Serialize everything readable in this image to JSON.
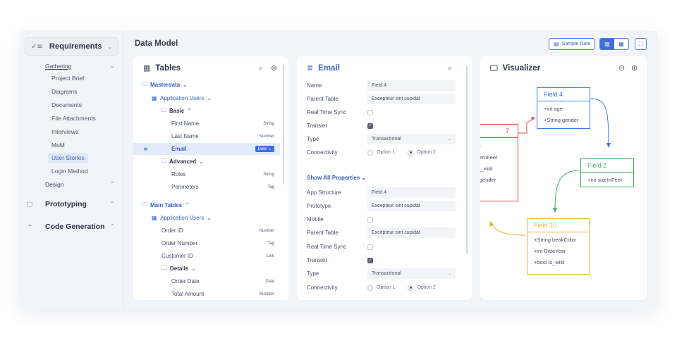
{
  "sidebar": {
    "requirements_label": "Requirements",
    "gathering_label": "Gathering",
    "gathering_items": [
      "Project Brief",
      "Diagrams",
      "Documents",
      "File Attachments",
      "Interviews",
      "MoM",
      "User Stories",
      "Login Method"
    ],
    "active_item": "User Stories",
    "design_label": "Design",
    "prototyping_label": "Prototyping",
    "code_generation_label": "Code Generation"
  },
  "header": {
    "title": "Data Model",
    "sample_data_label": "Sample Data"
  },
  "tables_panel": {
    "title": "Tables",
    "masterdata_label": "Masterdata",
    "application_users_label": "Application Users",
    "basic_label": "Basic",
    "basic_fields": [
      {
        "name": "First Name",
        "type": "String"
      },
      {
        "name": "Last Name",
        "type": "Number"
      }
    ],
    "selected_field": {
      "name": "Email",
      "type": "Date"
    },
    "advanced_label": "Advanced",
    "advanced_fields": [
      {
        "name": "Roles",
        "type": "String"
      },
      {
        "name": "Perimeters",
        "type": "Tag"
      }
    ],
    "main_tables_label": "Main Tables",
    "application_users_2_label": "Application Users",
    "main_fields": [
      {
        "name": "Order ID",
        "type": "Number"
      },
      {
        "name": "Order Number",
        "type": "Tag"
      },
      {
        "name": "Customer ID",
        "type": "Link"
      }
    ],
    "details_label": "Details",
    "details_fields": [
      {
        "name": "Order Date",
        "type": "Date"
      },
      {
        "name": "Total Amount",
        "type": "Number"
      }
    ]
  },
  "email_panel": {
    "title": "Email",
    "labels": {
      "name": "Name",
      "parent_table": "Parent Table",
      "real_time_sync": "Real Time Sync",
      "transiet": "Transiet",
      "type": "Type",
      "connectivity": "Connectivity",
      "app_structure": "App Structure",
      "prototype": "Prototype",
      "mobile": "Mobile"
    },
    "values": {
      "name": "Field 4",
      "parent_table": "Excepteur sint cupidat",
      "type": "Transactional",
      "app_structure": "Field 4",
      "prototype": "Excepteur sint cupidat",
      "parent_table_2": "Excepteur sint cupidat",
      "type_2": "Transactional"
    },
    "option1_label": "Option 1",
    "option2_label": "Option 2",
    "show_all_label": "Show All Properties"
  },
  "visualizer": {
    "title": "Visualizer",
    "field4": {
      "title": "Field 4",
      "lines": [
        "+int age",
        "+String gender"
      ],
      "color": "#3d7be0"
    },
    "field2": {
      "title": "Field 2",
      "lines": [
        "+int sizeInFeet"
      ],
      "color": "#3fae5a"
    },
    "field10": {
      "title": "Field 10",
      "lines": [
        "+String beakColor",
        "+int DateYear",
        "+bool is_wild"
      ],
      "color": "#e6b43a"
    },
    "field7": {
      "title": "7",
      "lines": [
        "je",
        "zeInFeet",
        "is_wild",
        "j gender"
      ],
      "color": "#e4453b"
    }
  },
  "colors": {
    "accent": "#3d6fd6",
    "sidebar_active_bg": "#dfe8f7",
    "selected_row_bg": "#e3ebf8"
  }
}
